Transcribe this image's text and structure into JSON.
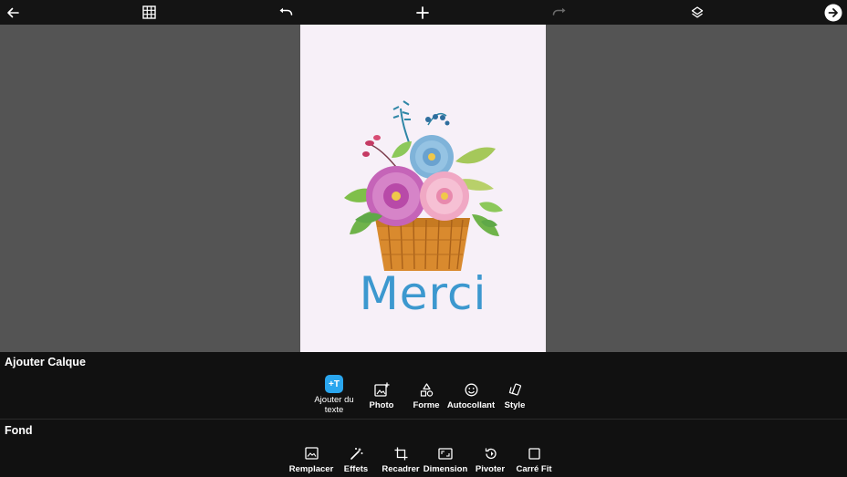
{
  "toolbar": {
    "icons": [
      "back-arrow-icon",
      "grid-icon",
      "undo-icon",
      "add-icon",
      "redo-icon",
      "layers-icon",
      "next-icon"
    ]
  },
  "card": {
    "caption": "Merci",
    "background_color": "#f7f0f8",
    "caption_color": "#3c98cf"
  },
  "layer_panel": {
    "title": "Ajouter Calque",
    "tools": [
      {
        "label": "Ajouter du texte",
        "icon": "add-text-icon"
      },
      {
        "label": "Photo",
        "icon": "add-photo-icon"
      },
      {
        "label": "Forme",
        "icon": "shapes-icon"
      },
      {
        "label": "Autocollant",
        "icon": "sticker-icon"
      },
      {
        "label": "Style",
        "icon": "style-icon"
      }
    ],
    "add_text_badge": "+T"
  },
  "background_panel": {
    "title": "Fond",
    "tools": [
      {
        "label": "Remplacer",
        "icon": "replace-image-icon"
      },
      {
        "label": "Effets",
        "icon": "magic-wand-icon"
      },
      {
        "label": "Recadrer",
        "icon": "crop-icon"
      },
      {
        "label": "Dimension",
        "icon": "aspect-ratio-icon"
      },
      {
        "label": "Pivoter",
        "icon": "rotate-icon"
      },
      {
        "label": "Carré Fit",
        "icon": "square-fit-icon"
      }
    ]
  },
  "colors": {
    "toolbar_bg": "#141414",
    "workspace_bg": "#545454",
    "panel_bg": "#111111",
    "accent": "#2aa6ee"
  }
}
